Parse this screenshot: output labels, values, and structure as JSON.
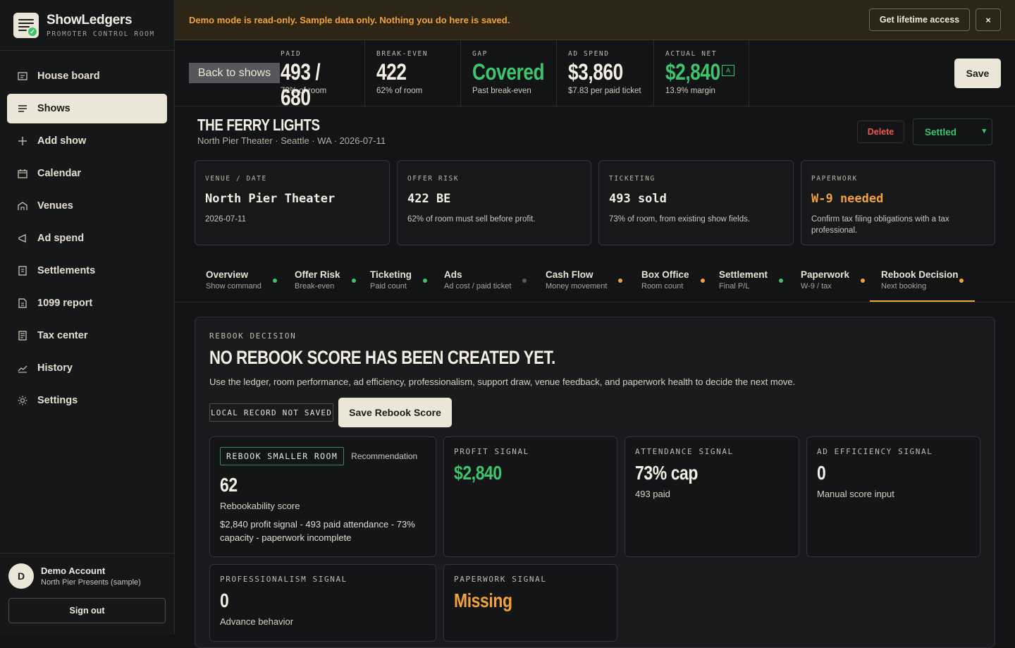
{
  "app": {
    "name": "ShowLedgers",
    "tagline": "PROMOTER CONTROL ROOM"
  },
  "sidebar": {
    "items": [
      {
        "label": "House board",
        "icon": "board-icon"
      },
      {
        "label": "Shows",
        "icon": "list-icon",
        "active": true
      },
      {
        "label": "Add show",
        "icon": "plus-icon"
      },
      {
        "label": "Calendar",
        "icon": "calendar-icon"
      },
      {
        "label": "Venues",
        "icon": "venue-icon"
      },
      {
        "label": "Ad spend",
        "icon": "megaphone-icon"
      },
      {
        "label": "Settlements",
        "icon": "document-icon"
      },
      {
        "label": "1099 report",
        "icon": "report-icon"
      },
      {
        "label": "Tax center",
        "icon": "tax-icon"
      },
      {
        "label": "History",
        "icon": "chart-icon"
      },
      {
        "label": "Settings",
        "icon": "gear-icon"
      }
    ],
    "account": {
      "initial": "D",
      "name": "Demo Account",
      "org": "North Pier Presents (sample)",
      "signout": "Sign out"
    }
  },
  "banner": {
    "text": "Demo mode is read-only. Sample data only. Nothing you do here is saved.",
    "cta": "Get lifetime access",
    "close": "×"
  },
  "stats": {
    "back": "Back to shows",
    "items": [
      {
        "label": "PAID",
        "value": "493 / 680",
        "sub": "73% of room"
      },
      {
        "label": "BREAK-EVEN",
        "value": "422",
        "sub": "62% of room"
      },
      {
        "label": "GAP",
        "value": "Covered",
        "sub": "Past break-even"
      },
      {
        "label": "AD SPEND",
        "value": "$3,860",
        "sub": "$7.83 per paid ticket"
      },
      {
        "label": "ACTUAL NET",
        "value": "$2,840",
        "sub": "13.9% margin",
        "badge": "A"
      }
    ],
    "save": "Save"
  },
  "show": {
    "title": "THE FERRY LIGHTS",
    "subtitle": "North Pier Theater · Seattle · WA · 2026-07-11",
    "delete": "Delete",
    "status": "Settled"
  },
  "cards": [
    {
      "label": "VENUE / DATE",
      "value": "North Pier Theater",
      "desc": "2026-07-11"
    },
    {
      "label": "OFFER RISK",
      "value": "422 BE",
      "desc": "62% of room must sell before profit."
    },
    {
      "label": "TICKETING",
      "value": "493 sold",
      "desc": "73% of room, from existing show fields."
    },
    {
      "label": "PAPERWORK",
      "value": "W-9 needed",
      "desc": "Confirm tax filing obligations with a tax professional."
    }
  ],
  "tabs": [
    {
      "title": "Overview",
      "sub": "Show command",
      "dot": "#3ec46d"
    },
    {
      "title": "Offer Risk",
      "sub": "Break-even",
      "dot": "#3ec46d"
    },
    {
      "title": "Ticketing",
      "sub": "Paid count",
      "dot": "#3ec46d"
    },
    {
      "title": "Ads",
      "sub": "Ad cost / paid ticket",
      "dot": "#5a5a5a"
    },
    {
      "title": "Cash Flow",
      "sub": "Money movement",
      "dot": "#f2a23a"
    },
    {
      "title": "Box Office",
      "sub": "Room count",
      "dot": "#f2a23a"
    },
    {
      "title": "Settlement",
      "sub": "Final P/L",
      "dot": "#3ec46d"
    },
    {
      "title": "Paperwork",
      "sub": "W-9 / tax",
      "dot": "#f2a23a"
    },
    {
      "title": "Rebook Decision",
      "sub": "Next booking",
      "dot": "#f2a23a",
      "active": true
    }
  ],
  "rebook": {
    "label": "REBOOK DECISION",
    "title": "NO REBOOK SCORE HAS BEEN CREATED YET.",
    "desc": "Use the ledger, room performance, ad efficiency, professionalism, support draw, venue feedback, and paperwork health to decide the next move.",
    "local_tag": "LOCAL RECORD NOT SAVED",
    "save": "Save Rebook Score",
    "recommendation": {
      "tag": "REBOOK SMALLER ROOM",
      "side": "Recommendation",
      "score": "62",
      "score_label": "Rebookability score",
      "detail": "$2,840 profit signal - 493 paid attendance - 73% capacity - paperwork incomplete"
    },
    "signals": [
      {
        "label": "PROFIT SIGNAL",
        "value": "$2,840",
        "sub": "",
        "color": "green"
      },
      {
        "label": "ATTENDANCE SIGNAL",
        "value": "73% cap",
        "sub": "493 paid",
        "color": ""
      },
      {
        "label": "AD EFFICIENCY SIGNAL",
        "value": "0",
        "sub": "Manual score input",
        "color": ""
      },
      {
        "label": "PROFESSIONALISM SIGNAL",
        "value": "0",
        "sub": "Advance behavior",
        "color": ""
      },
      {
        "label": "PAPERWORK SIGNAL",
        "value": "Missing",
        "sub": "",
        "color": "orange"
      }
    ]
  },
  "colors": {
    "accent_green": "#3ec46d",
    "accent_orange": "#f2a23a",
    "cream": "#ece6d8",
    "danger": "#ef5a4e"
  }
}
